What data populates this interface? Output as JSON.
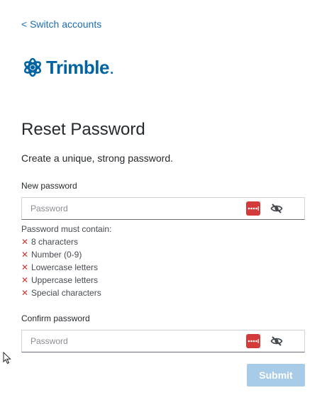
{
  "switch_accounts": "< Switch accounts",
  "logo": {
    "text": "Trimble",
    "dot": "."
  },
  "title": "Reset Password",
  "subtitle": "Create a unique, strong password.",
  "new_password": {
    "label": "New password",
    "placeholder": "Password",
    "value": ""
  },
  "rules": {
    "title": "Password must contain:",
    "items": [
      {
        "status": "unmet",
        "label": "8 characters"
      },
      {
        "status": "unmet",
        "label": "Number (0-9)"
      },
      {
        "status": "unmet",
        "label": "Lowercase letters"
      },
      {
        "status": "unmet",
        "label": "Uppercase letters"
      },
      {
        "status": "unmet",
        "label": "Special characters"
      }
    ],
    "unmet_symbol": "✕"
  },
  "confirm_password": {
    "label": "Confirm password",
    "placeholder": "Password",
    "value": ""
  },
  "submit": {
    "label": "Submit",
    "enabled": false
  },
  "colors": {
    "link": "#1e6db5",
    "brand": "#0063a3",
    "error": "#d43535",
    "password_manager": "#d33b3b",
    "submit_disabled": "#a8cbe8"
  },
  "icons": {
    "password_manager": "password-manager-icon",
    "toggle_visibility": "eye-off-icon"
  }
}
